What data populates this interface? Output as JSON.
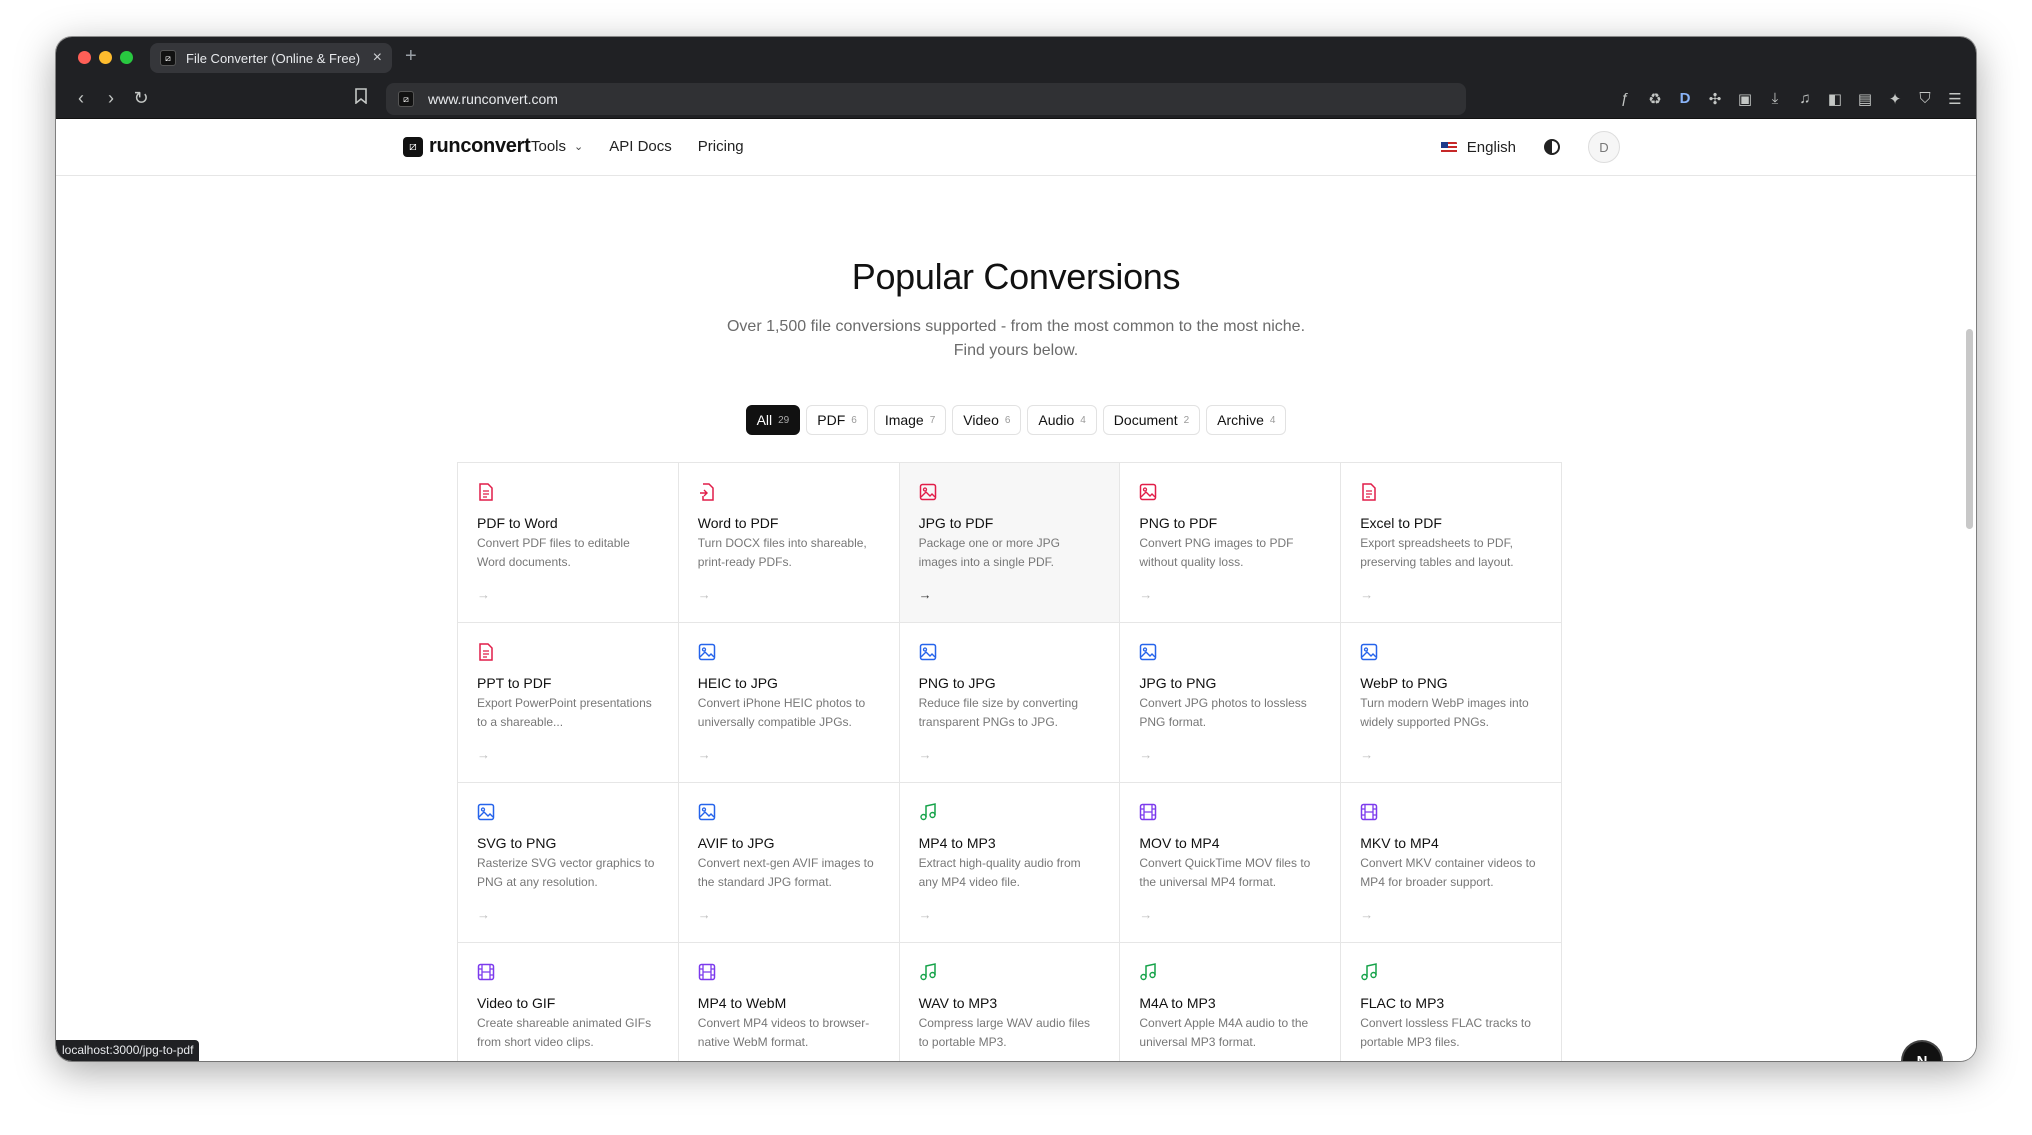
{
  "browser": {
    "tab_title": "File Converter (Online & Free)",
    "url": "www.runconvert.com",
    "status_url": "localhost:3000/jpg-to-pdf"
  },
  "colors": {
    "pdf_icon": "#e11d48",
    "image_icon": "#2563eb",
    "video_icon": "#7c3aed",
    "audio_icon": "#16a34a",
    "accent": "#111111"
  },
  "header": {
    "logo": "runconvert",
    "nav": {
      "tools": "Tools",
      "api_docs": "API Docs",
      "pricing": "Pricing"
    },
    "language": "English",
    "avatar_initial": "D"
  },
  "hero": {
    "title": "Popular Conversions",
    "subtitle": "Over 1,500 file conversions supported - from the most common to the most niche. Find yours below."
  },
  "filters": [
    {
      "label": "All",
      "count": "29"
    },
    {
      "label": "PDF",
      "count": "6"
    },
    {
      "label": "Image",
      "count": "7"
    },
    {
      "label": "Video",
      "count": "6"
    },
    {
      "label": "Audio",
      "count": "4"
    },
    {
      "label": "Document",
      "count": "2"
    },
    {
      "label": "Archive",
      "count": "4"
    }
  ],
  "cards": [
    {
      "title": "PDF to Word",
      "desc": "Convert PDF files to editable Word documents.",
      "icon": "file-text-icon"
    },
    {
      "title": "Word to PDF",
      "desc": "Turn DOCX files into shareable, print-ready PDFs.",
      "icon": "file-export-icon"
    },
    {
      "title": "JPG to PDF",
      "desc": "Package one or more JPG images into a single PDF.",
      "icon": "image-icon"
    },
    {
      "title": "PNG to PDF",
      "desc": "Convert PNG images to PDF without quality loss.",
      "icon": "image-icon"
    },
    {
      "title": "Excel to PDF",
      "desc": "Export spreadsheets to PDF, preserving tables and layout.",
      "icon": "file-text-icon"
    },
    {
      "title": "PPT to PDF",
      "desc": "Export PowerPoint presentations to a shareable...",
      "icon": "file-text-icon"
    },
    {
      "title": "HEIC to JPG",
      "desc": "Convert iPhone HEIC photos to universally compatible JPGs.",
      "icon": "image-icon"
    },
    {
      "title": "PNG to JPG",
      "desc": "Reduce file size by converting transparent PNGs to JPG.",
      "icon": "image-icon"
    },
    {
      "title": "JPG to PNG",
      "desc": "Convert JPG photos to lossless PNG format.",
      "icon": "image-icon"
    },
    {
      "title": "WebP to PNG",
      "desc": "Turn modern WebP images into widely supported PNGs.",
      "icon": "image-icon"
    },
    {
      "title": "SVG to PNG",
      "desc": "Rasterize SVG vector graphics to PNG at any resolution.",
      "icon": "image-icon"
    },
    {
      "title": "AVIF to JPG",
      "desc": "Convert next-gen AVIF images to the standard JPG format.",
      "icon": "image-icon"
    },
    {
      "title": "MP4 to MP3",
      "desc": "Extract high-quality audio from any MP4 video file.",
      "icon": "music-note-icon"
    },
    {
      "title": "MOV to MP4",
      "desc": "Convert QuickTime MOV files to the universal MP4 format.",
      "icon": "film-icon"
    },
    {
      "title": "MKV to MP4",
      "desc": "Convert MKV container videos to MP4 for broader support.",
      "icon": "film-icon"
    },
    {
      "title": "Video to GIF",
      "desc": "Create shareable animated GIFs from short video clips.",
      "icon": "film-icon"
    },
    {
      "title": "MP4 to WebM",
      "desc": "Convert MP4 videos to browser-native WebM format.",
      "icon": "film-icon"
    },
    {
      "title": "WAV to MP3",
      "desc": "Compress large WAV audio files to portable MP3.",
      "icon": "music-note-icon"
    },
    {
      "title": "M4A to MP3",
      "desc": "Convert Apple M4A audio to the universal MP3 format.",
      "icon": "music-note-icon"
    },
    {
      "title": "FLAC to MP3",
      "desc": "Convert lossless FLAC tracks to portable MP3 files.",
      "icon": "music-note-icon"
    }
  ],
  "dev_badge": "N"
}
